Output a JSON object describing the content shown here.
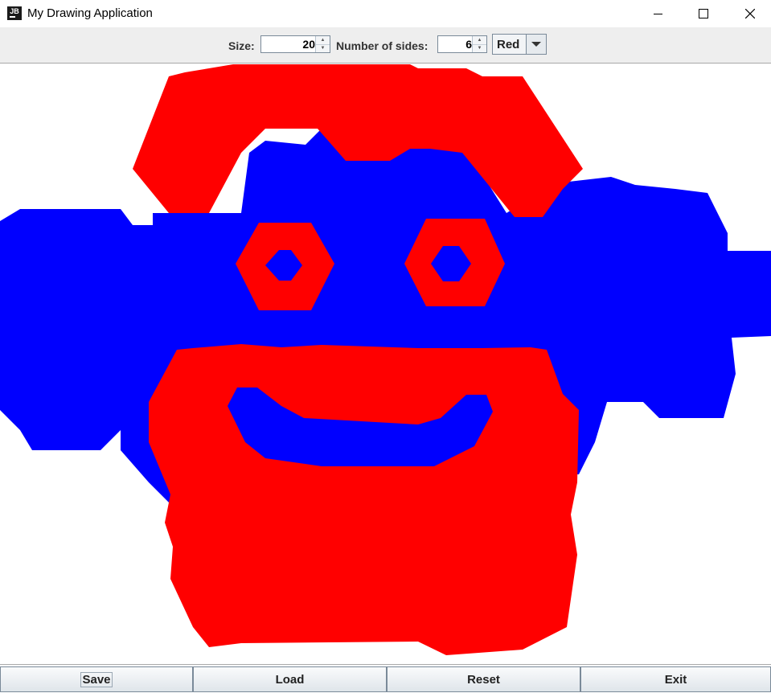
{
  "window": {
    "title": "My Drawing Application",
    "icon_text": "JB",
    "controls": [
      "minimize-icon",
      "maximize-icon",
      "close-icon"
    ]
  },
  "toolbar": {
    "size_label": "Size:",
    "size_value": "20",
    "sides_label": "Number of sides:",
    "sides_value": "6",
    "color_selected": "Red"
  },
  "colors": {
    "red": "#ff0000",
    "blue": "#0000ff",
    "canvas": "#ffffff"
  },
  "buttons": {
    "save": "Save",
    "load": "Load",
    "reset": "Reset",
    "exit": "Exit"
  }
}
